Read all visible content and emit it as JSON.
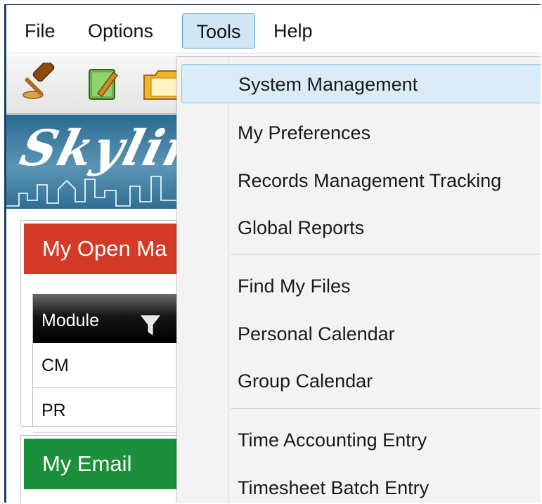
{
  "menubar": {
    "file": "File",
    "options": "Options",
    "tools": "Tools",
    "help": "Help"
  },
  "toolbar": {
    "icons": [
      "gavel-icon",
      "notebook-icon",
      "folder-icon"
    ]
  },
  "banner": {
    "text": "Skylin"
  },
  "open_matters_panel": {
    "title": "My Open Ma",
    "header_color": "#d33a27",
    "grid": {
      "column": "Module",
      "rows": [
        "CM",
        "PR"
      ]
    }
  },
  "email_panel": {
    "title": "My Email",
    "header_color": "#1b8f3a"
  },
  "tools_menu": {
    "groups": [
      [
        "System Management",
        "My Preferences",
        "Records Management Tracking",
        "Global Reports"
      ],
      [
        "Find My Files",
        "Personal Calendar",
        "Group Calendar"
      ],
      [
        "Time Accounting Entry",
        "Timesheet Batch Entry"
      ]
    ],
    "highlighted": "System Management"
  }
}
